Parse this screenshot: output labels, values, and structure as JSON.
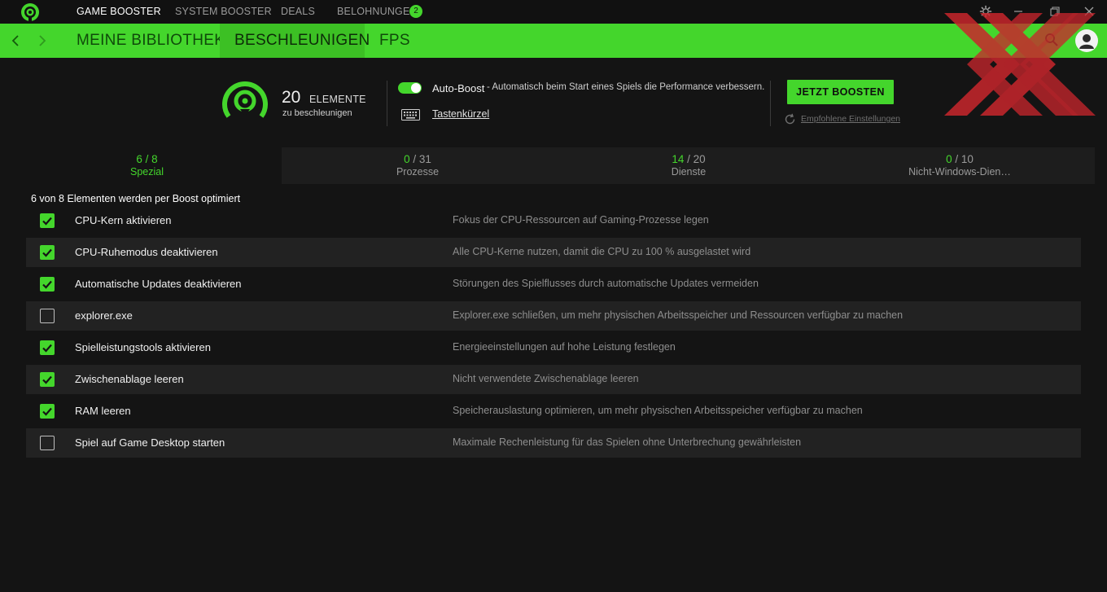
{
  "topnav": {
    "items": [
      "GAME BOOSTER",
      "SYSTEM BOOSTER",
      "DEALS",
      "BELOHNUNGEN"
    ],
    "rewards_badge": "2",
    "active": "GAME BOOSTER"
  },
  "subnav": {
    "tabs": [
      "MEINE BIBLIOTHEK",
      "BESCHLEUNIGEN",
      "FPS"
    ],
    "active": "BESCHLEUNIGEN"
  },
  "summary": {
    "count": "20",
    "count_label": "ELEMENTE",
    "count_sub": "zu beschleunigen",
    "autoboost_label": "Auto-Boost",
    "autoboost_desc": "- Automatisch beim Start eines Spiels die Performance verbessern.",
    "autoboost_on": true,
    "shortcut_label": "Tastenkürzel",
    "boost_button": "JETZT BOOSTEN",
    "recommended_link": "Empfohlene Einstellungen"
  },
  "tabs": [
    {
      "selected": "6",
      "total": "/ 8",
      "name": "Spezial",
      "active": true
    },
    {
      "selected": "0",
      "total": "/ 31",
      "name": "Prozesse",
      "active": false
    },
    {
      "selected": "14",
      "total": "/ 20",
      "name": "Dienste",
      "active": false
    },
    {
      "selected": "0",
      "total": "/ 10",
      "name": "Nicht-Windows-Dien…",
      "active": false
    }
  ],
  "list": {
    "title": "6 von 8 Elementen werden per Boost optimiert",
    "items": [
      {
        "name": "CPU-Kern aktivieren",
        "desc": "Fokus der CPU-Ressourcen auf Gaming-Prozesse legen",
        "checked": true
      },
      {
        "name": "CPU-Ruhemodus deaktivieren",
        "desc": "Alle CPU-Kerne nutzen, damit die CPU zu 100 % ausgelastet wird",
        "checked": true
      },
      {
        "name": "Automatische Updates deaktivieren",
        "desc": "Störungen des Spielflusses durch automatische Updates vermeiden",
        "checked": true
      },
      {
        "name": "explorer.exe",
        "desc": "Explorer.exe schließen, um mehr physischen Arbeitsspeicher und Ressourcen verfügbar zu machen",
        "checked": false
      },
      {
        "name": "Spielleistungstools aktivieren",
        "desc": "Energieeinstellungen auf hohe Leistung festlegen",
        "checked": true
      },
      {
        "name": "Zwischenablage leeren",
        "desc": "Nicht verwendete Zwischenablage leeren",
        "checked": true
      },
      {
        "name": "RAM leeren",
        "desc": "Speicherauslastung optimieren, um mehr physischen Arbeitsspeicher verfügbar zu machen",
        "checked": true
      },
      {
        "name": "Spiel auf Game Desktop starten",
        "desc": "Maximale Rechenleistung für das Spielen ohne Unterbrechung gewährleisten",
        "checked": false
      }
    ]
  },
  "colors": {
    "accent": "#44d62c",
    "background": "#141414",
    "row_alt": "#222222"
  }
}
